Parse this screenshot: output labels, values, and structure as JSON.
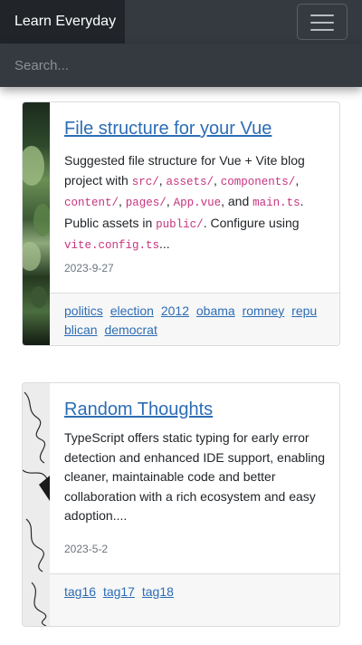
{
  "navbar": {
    "brand": "Learn Everyday",
    "menu_icon": "hamburger-menu-icon"
  },
  "search": {
    "placeholder": "Search...",
    "value": ""
  },
  "posts": [
    {
      "title": "File structure for your Vue",
      "excerpt_parts": [
        "Suggested file structure for Vue + Vite blog project with ",
        "src/",
        ", ",
        "assets/",
        ", ",
        "components/",
        ", ",
        "content/",
        ", ",
        "pages/",
        ", ",
        "App.vue",
        ", and ",
        "main.ts",
        ". Public assets in ",
        "public/",
        ". Configure using ",
        "vite.config.ts",
        "..."
      ],
      "date": "2023-9-27",
      "tags": [
        "politics",
        "election",
        "2012",
        "obama",
        "romney",
        "repu",
        "blican",
        "democrat"
      ]
    },
    {
      "title": "Random Thoughts",
      "excerpt": "TypeScript offers static typing for early error detection and enhanced IDE support, enabling cleaner, maintainable code and better collaboration with a rich ecosystem and easy adoption....",
      "date": "2023-5-2",
      "tags": [
        "tag16",
        "tag17",
        "tag18"
      ]
    }
  ]
}
